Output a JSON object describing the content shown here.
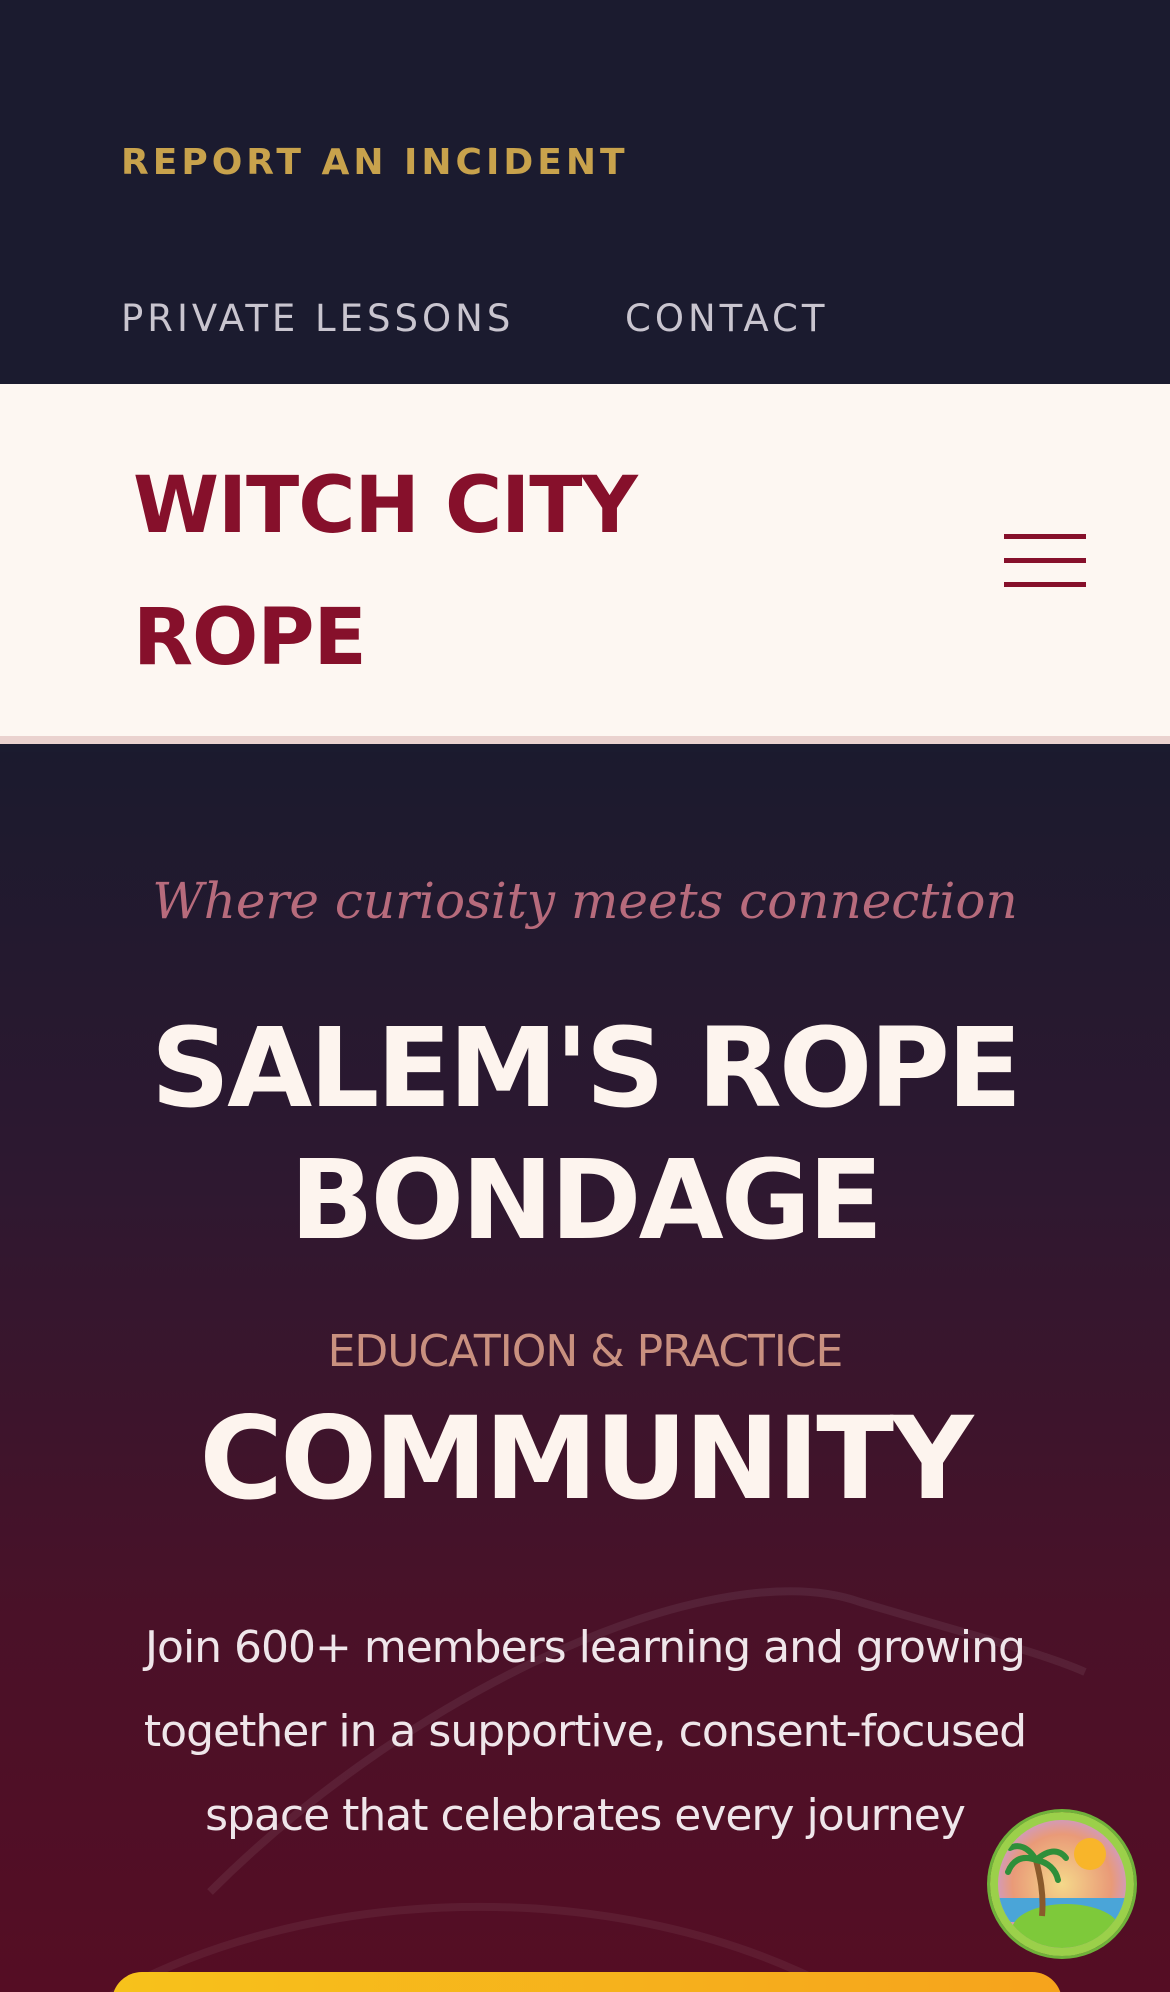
{
  "top_nav": {
    "report_label": "REPORT AN INCIDENT",
    "links": [
      "PRIVATE LESSONS",
      "CONTACT"
    ]
  },
  "header": {
    "brand": "WITCH CITY ROPE",
    "menu_icon": "hamburger-menu-icon"
  },
  "hero": {
    "tagline": "Where curiosity meets connection",
    "title": "SALEM'S ROPE BONDAGE",
    "subtitle": "EDUCATION & PRACTICE",
    "community": "COMMUNITY",
    "description": "Join 600+ members learning and growing together in a supportive, consent-focused space that celebrates every journey"
  },
  "floating_badge": {
    "icon": "tropical-island-icon"
  },
  "colors": {
    "nav_bg": "#1b1b2f",
    "gold": "#c8a24c",
    "brand_red": "#86102b",
    "header_bg": "#fdf7f2",
    "cta_yellow": "#f7c21b"
  }
}
